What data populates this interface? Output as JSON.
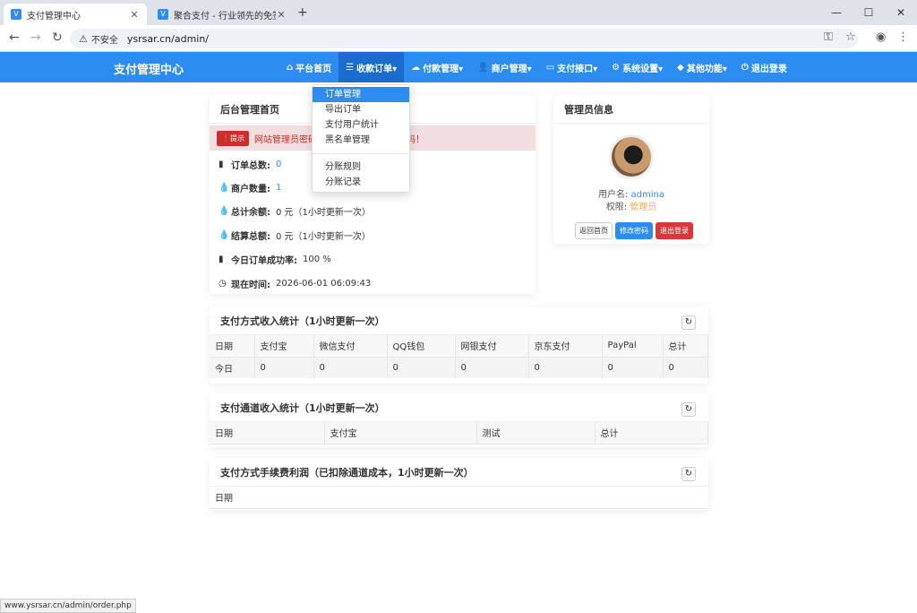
{
  "browser": {
    "tabs": [
      {
        "title": "支付管理中心",
        "close": "✕"
      },
      {
        "title": "聚合支付 - 行业领先的免签约支",
        "close": "✕"
      }
    ],
    "new_tab": "+",
    "window_controls": [
      "—",
      "☐",
      "✕"
    ],
    "security_label": "不安全",
    "url": "ysrsar.cn/admin/"
  },
  "site": {
    "brand": "支付管理中心",
    "nav": [
      {
        "icon": "⌂",
        "label": "平台首页"
      },
      {
        "icon": "☰",
        "label": "收款订单▾"
      },
      {
        "icon": "☁",
        "label": "付款管理▾"
      },
      {
        "icon": "👤",
        "label": "商户管理▾"
      },
      {
        "icon": "▭",
        "label": "支付接口▾"
      },
      {
        "icon": "⚙",
        "label": "系统设置▾"
      },
      {
        "icon": "◆",
        "label": "其他功能▾"
      },
      {
        "icon": "⏻",
        "label": "退出登录"
      }
    ],
    "dropdown": [
      "订单管理",
      "导出订单",
      "支付用户统计",
      "黑名单管理",
      "分账规则",
      "分账记录"
    ]
  },
  "home": {
    "title": "后台管理首页",
    "alert_badge": "❗提示",
    "alert_text": "网站管理员密码",
    "alert_tail": "码！",
    "stats": [
      {
        "icon": "▮",
        "label": "订单总数:",
        "value": "0"
      },
      {
        "icon": "💧",
        "label": "商户数量:",
        "value": "1"
      },
      {
        "icon": "💧",
        "label": "总计余额:",
        "value": "0 元（1小时更新一次）"
      },
      {
        "icon": "💧",
        "label": "结算总额:",
        "value": "0 元（1小时更新一次）"
      },
      {
        "icon": "▮",
        "label": "今日订单成功率:",
        "value": "100 %"
      },
      {
        "icon": "◷",
        "label": "现在时间:",
        "value": "2026-06-01 06:09:43"
      }
    ]
  },
  "admin": {
    "title": "管理员信息",
    "username_label": "用户名:",
    "username": "admina",
    "role_label": "权限:",
    "role": "管理员",
    "buttons": [
      "返回首页",
      "修改密码",
      "退出登录"
    ]
  },
  "pay_method": {
    "title": "支付方式收入统计（1小时更新一次）",
    "columns": [
      "日期",
      "支付宝",
      "微信支付",
      "QQ钱包",
      "网银支付",
      "京东支付",
      "PayPal",
      "总计"
    ],
    "row": [
      "今日",
      "0",
      "0",
      "0",
      "0",
      "0",
      "0",
      "0"
    ]
  },
  "channel": {
    "title": "支付通道收入统计（1小时更新一次）",
    "columns": [
      "日期",
      "支付宝",
      "测试",
      "总计"
    ]
  },
  "fee": {
    "title": "支付方式手续费利润（已扣除通道成本，1小时更新一次）",
    "columns": [
      "日期"
    ]
  },
  "statusbar": "www.ysrsar.cn/admin/order.php"
}
